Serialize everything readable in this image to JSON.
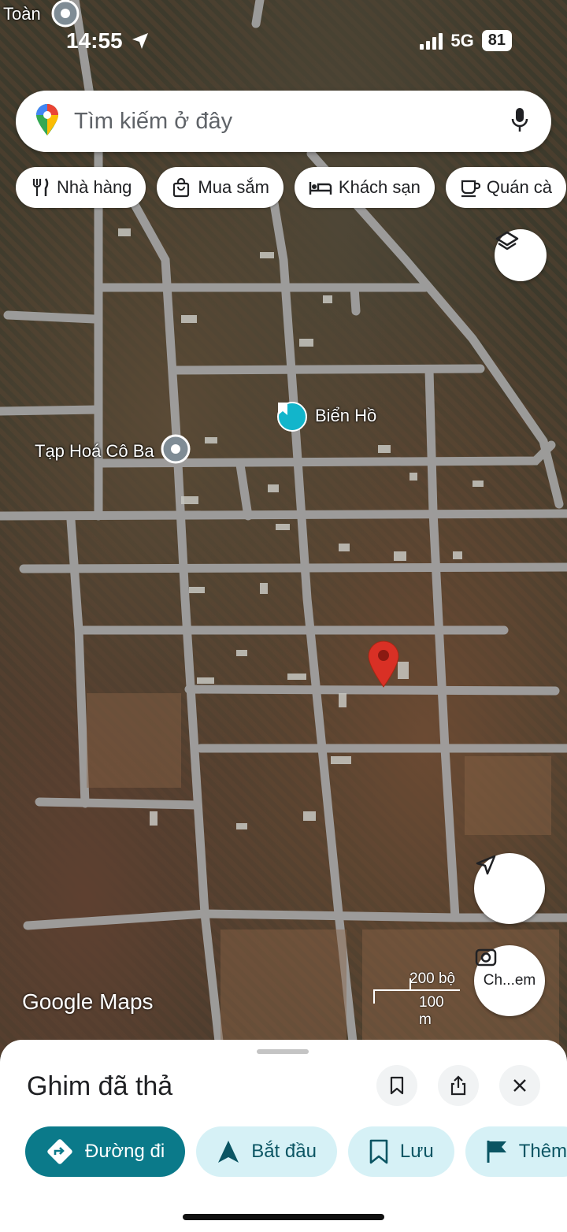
{
  "status_bar": {
    "time": "14:55",
    "network": "5G",
    "battery": "81",
    "corner_label": "Toàn"
  },
  "search": {
    "placeholder": "Tìm kiếm ở đây"
  },
  "categories": [
    {
      "label": "Nhà hàng",
      "icon": "utensils-icon"
    },
    {
      "label": "Mua sắm",
      "icon": "shopping-bag-icon"
    },
    {
      "label": "Khách sạn",
      "icon": "bed-icon"
    },
    {
      "label": "Quán cà",
      "icon": "coffee-icon"
    }
  ],
  "map": {
    "poi_1": "Biển Hồ",
    "poi_2": "Tạp Hoá Cô Ba",
    "brand": "Google Maps",
    "scale_imperial": "200 bộ",
    "scale_metric": "100 m",
    "lens_label": "Ch...em"
  },
  "sheet": {
    "title": "Ghim đã thả",
    "actions": [
      {
        "label": "Đường đi",
        "icon": "directions-icon"
      },
      {
        "label": "Bắt đầu",
        "icon": "navigation-arrow-icon"
      },
      {
        "label": "Lưu",
        "icon": "bookmark-icon"
      },
      {
        "label": "Thêm",
        "icon": "flag-icon"
      }
    ]
  },
  "colors": {
    "primary": "#0b7a8a",
    "secondary_bg": "#d6f1f6",
    "pin": "#d93025",
    "road": "#9a9a9a"
  }
}
